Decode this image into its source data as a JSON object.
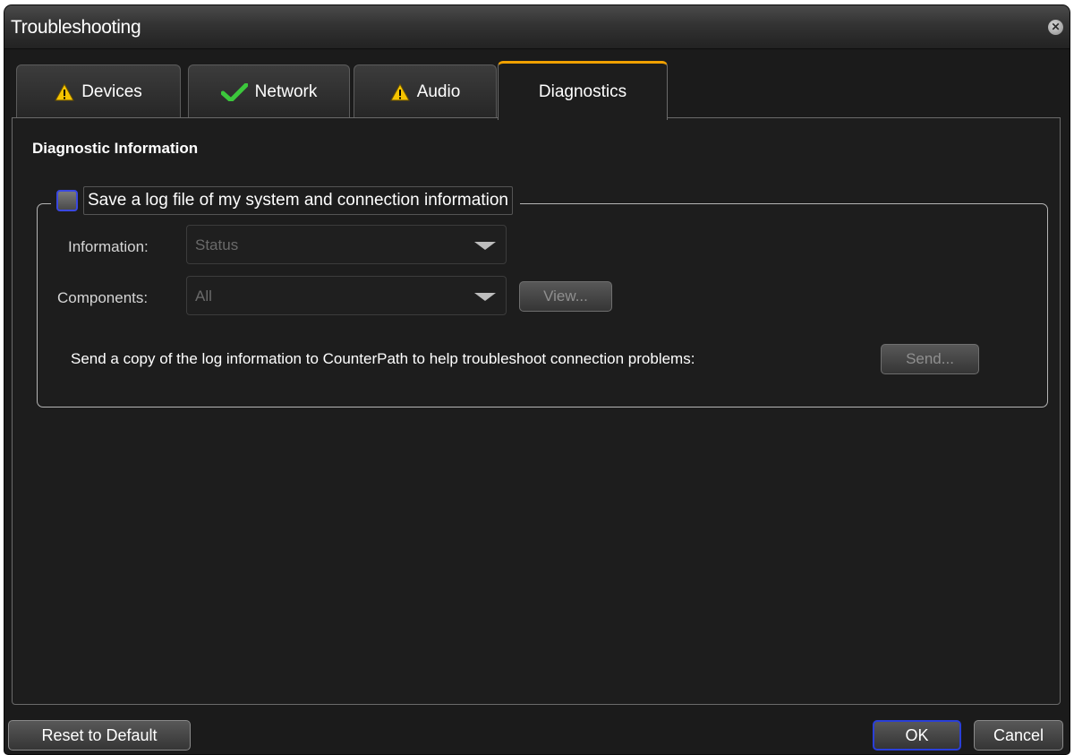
{
  "window": {
    "title": "Troubleshooting",
    "close_icon": "close-icon"
  },
  "tabs": [
    {
      "label": "Devices",
      "icon": "warning-icon"
    },
    {
      "label": "Network",
      "icon": "checkmark-icon"
    },
    {
      "label": "Audio",
      "icon": "warning-icon"
    },
    {
      "label": "Diagnostics",
      "icon": null,
      "active": true
    }
  ],
  "diagnostics": {
    "heading": "Diagnostic Information",
    "log_checkbox": {
      "label": "Save a log file of my system and connection information",
      "checked": false
    },
    "information": {
      "label": "Information:",
      "value": "Status"
    },
    "components": {
      "label": "Components:",
      "value": "All"
    },
    "view_button": "View...",
    "send_text": "Send a copy of the log information to CounterPath to help troubleshoot connection problems:",
    "send_button": "Send..."
  },
  "footer": {
    "reset_button": "Reset to Default",
    "ok_button": "OK",
    "cancel_button": "Cancel"
  },
  "colors": {
    "active_tab_accent": "#f0a000",
    "warning_icon": "#f5c400",
    "check_icon": "#3cc83c",
    "focus_border": "#2a3fd8"
  }
}
